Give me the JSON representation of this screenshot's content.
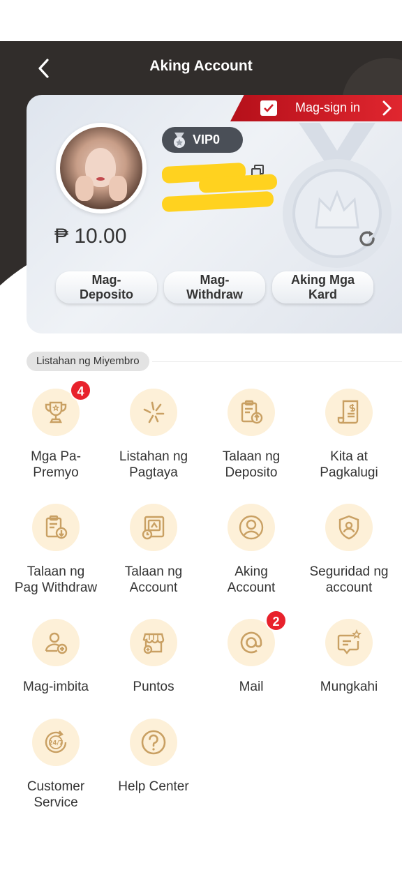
{
  "header": {
    "title": "Aking Account",
    "signin_label": "Mag-sign in"
  },
  "profile": {
    "vip_level": "VIP0",
    "balance": "₱ 10.00"
  },
  "actions": [
    {
      "label_line1": "Mag-",
      "label_line2": "Deposito"
    },
    {
      "label_line1": "Mag-",
      "label_line2": "Withdraw"
    },
    {
      "label_line1": "Aking Mga",
      "label_line2": "Kard"
    }
  ],
  "section": {
    "title": "Listahan ng Miyembro"
  },
  "menu": [
    {
      "line1": "Mga Pa-",
      "line2": "Premyo",
      "icon": "trophy-icon",
      "badge": "4"
    },
    {
      "line1": "Listahan ng",
      "line2": "Pagtaya",
      "icon": "sparkle-icon",
      "badge": ""
    },
    {
      "line1": "Talaan ng",
      "line2": "Deposito",
      "icon": "clipboard-upload-icon",
      "badge": ""
    },
    {
      "line1": "Kita at",
      "line2": "Pagkalugi",
      "icon": "receipt-dollar-icon",
      "badge": ""
    },
    {
      "line1": "Talaan ng",
      "line2": "Pag Withdraw",
      "icon": "clipboard-download-icon",
      "badge": ""
    },
    {
      "line1": "Talaan ng",
      "line2": "Account",
      "icon": "account-record-icon",
      "badge": ""
    },
    {
      "line1": "Aking",
      "line2": "Account",
      "icon": "user-circle-icon",
      "badge": ""
    },
    {
      "line1": "Seguridad ng",
      "line2": "account",
      "icon": "shield-user-icon",
      "badge": ""
    },
    {
      "line1": "Mag-imbita",
      "line2": "",
      "icon": "invite-user-icon",
      "badge": ""
    },
    {
      "line1": "Puntos",
      "line2": "",
      "icon": "shop-points-icon",
      "badge": ""
    },
    {
      "line1": "Mail",
      "line2": "",
      "icon": "at-mail-icon",
      "badge": "2"
    },
    {
      "line1": "Mungkahi",
      "line2": "",
      "icon": "feedback-icon",
      "badge": ""
    },
    {
      "line1": "Customer",
      "line2": "Service",
      "icon": "customer-service-24-7-icon",
      "badge": ""
    },
    {
      "line1": "Help Center",
      "line2": "",
      "icon": "help-question-icon",
      "badge": ""
    }
  ],
  "colors": {
    "header_bg": "#312d2b",
    "accent_red": "#e0262f",
    "icon_bg": "#fdf0d8",
    "icon_gold": "#c9a063"
  }
}
